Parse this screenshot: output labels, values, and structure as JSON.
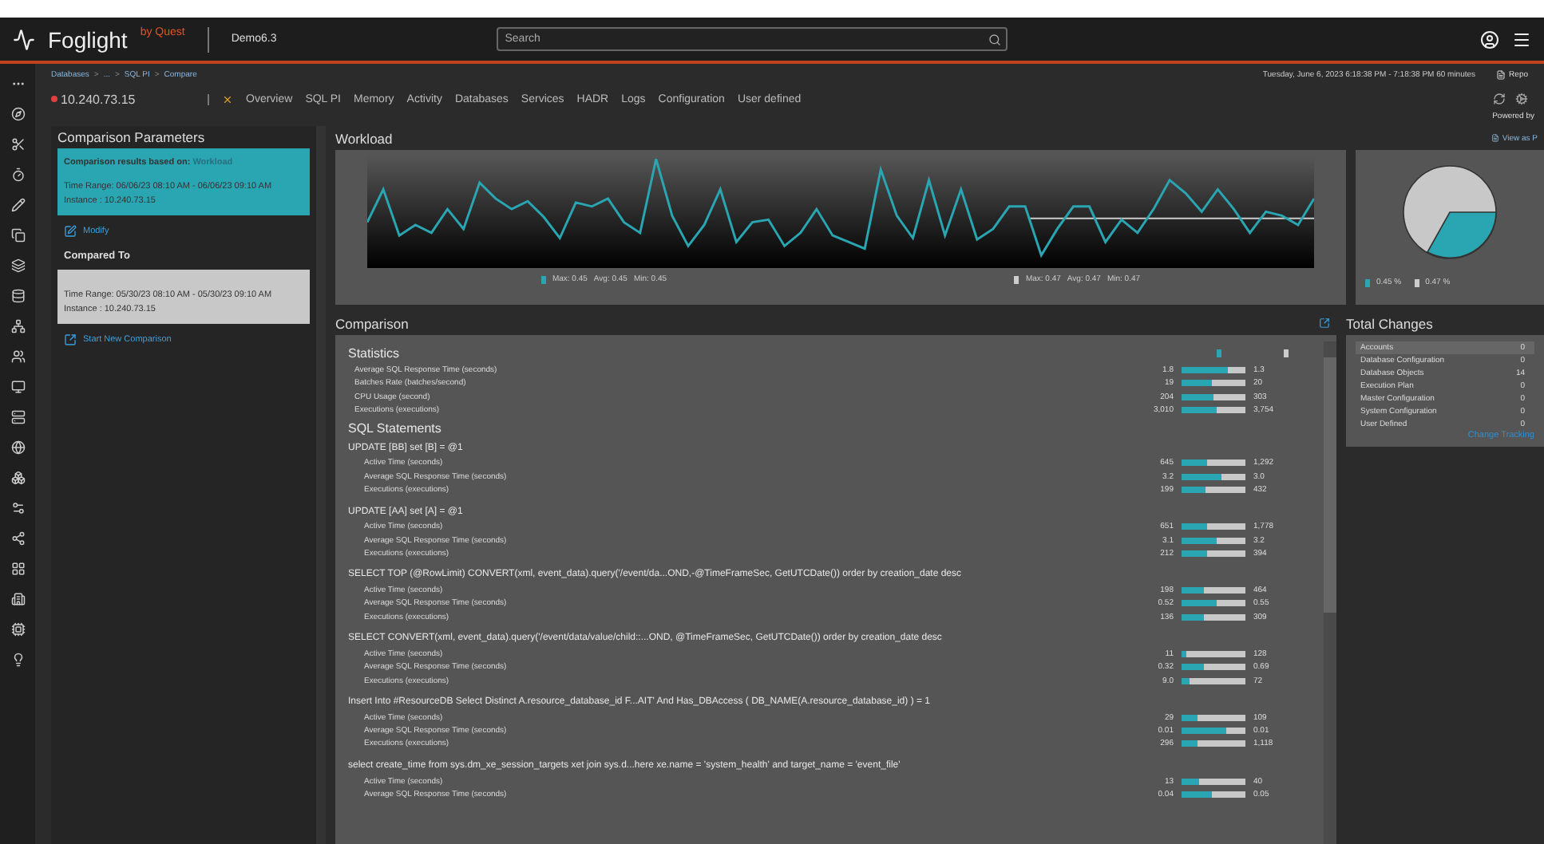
{
  "header": {
    "logo": "Foglight",
    "vendor": "by Quest",
    "instance": "Demo6.3",
    "search": {
      "placeholder": "Search"
    }
  },
  "breadcrumb": [
    {
      "label": "Databases"
    },
    {
      "separator": ">",
      "label": "..."
    },
    {
      "separator": ">",
      "label": "SQL PI"
    },
    {
      "separator": ">",
      "label": "Compare"
    }
  ],
  "time_range": "Tuesday, June 6, 2023 6:18:38 PM - 7:18:38 PM 60 minutes",
  "report": "Repo",
  "host": "10.240.73.15",
  "nav_tabs": [
    {
      "label": "Overview",
      "selected": false
    },
    {
      "label": "SQL PI",
      "selected": false
    },
    {
      "label": "Memory",
      "selected": false
    },
    {
      "label": "Activity",
      "selected": false
    },
    {
      "label": "Databases",
      "selected": false
    },
    {
      "label": "Services",
      "selected": false
    },
    {
      "label": "HADR",
      "selected": false
    },
    {
      "label": "Logs",
      "selected": false
    },
    {
      "label": "Configuration",
      "selected": false
    },
    {
      "label": "User defined",
      "selected": false
    }
  ],
  "powered_by": "Powered by",
  "comparison_parameters": {
    "title": "Comparison Parameters",
    "based_on_label": "Comparison results based on:",
    "based_on_value": "Workload",
    "baseline_time": "Time Range: 06/06/23 08:10 AM - 06/06/23 09:10 AM",
    "baseline_instance": "Instance : 10.240.73.15",
    "modify": "Modify",
    "compared_to": "Compared To",
    "compared_time": "Time Range: 05/30/23 08:10 AM - 05/30/23 09:10 AM",
    "compared_instance": "Instance : 10.240.73.15",
    "start_new": "Start New Comparison"
  },
  "workload": {
    "title": "Workload",
    "view_as": "View as P",
    "legend_a": [
      "Max: 0.45",
      "Avg: 0.45",
      "Min: 0.45"
    ],
    "legend_b": [
      "Max: 0.47",
      "Avg: 0.47",
      "Min: 0.47"
    ],
    "pie_legend": [
      "0.45 %",
      "0.47 %"
    ]
  },
  "comparison": {
    "title": "Comparison",
    "statistics_title": "Statistics",
    "statistics": [
      {
        "name": "Average SQL Response Time (seconds)",
        "a": "1.8",
        "b": "1.3",
        "level": 0.72
      },
      {
        "name": "Batches Rate (batches/second)",
        "a": "19",
        "b": "20",
        "level": 0.48
      },
      {
        "name": "CPU Usage (second)",
        "a": "204",
        "b": "303",
        "level": 0.5
      },
      {
        "name": "Executions (executions)",
        "a": "3,010",
        "b": "3,754",
        "level": 0.55
      }
    ],
    "sql_title": "SQL Statements",
    "statements": [
      {
        "text": "UPDATE [BB] set [B] = @1",
        "metrics": [
          {
            "name": "Active Time (seconds)",
            "a": "645",
            "b": "1,292",
            "level": 0.4
          },
          {
            "name": "Average SQL Response Time (seconds)",
            "a": "3.2",
            "b": "3.0",
            "level": 0.62
          },
          {
            "name": "Executions (executions)",
            "a": "199",
            "b": "432",
            "level": 0.37
          }
        ]
      },
      {
        "text": "UPDATE [AA] set [A] = @1",
        "metrics": [
          {
            "name": "Active Time (seconds)",
            "a": "651",
            "b": "1,778",
            "level": 0.4
          },
          {
            "name": "Average SQL Response Time (seconds)",
            "a": "3.1",
            "b": "3.2",
            "level": 0.56
          },
          {
            "name": "Executions (executions)",
            "a": "212",
            "b": "394",
            "level": 0.4
          }
        ]
      },
      {
        "text": "SELECT TOP (@RowLimit) CONVERT(xml, event_data).query('/event/da...OND,-@TimeFrameSec, GetUTCDate()) order by creation_date desc",
        "metrics": [
          {
            "name": "Active Time (seconds)",
            "a": "198",
            "b": "464",
            "level": 0.35
          },
          {
            "name": "Average SQL Response Time (seconds)",
            "a": "0.52",
            "b": "0.55",
            "level": 0.56
          },
          {
            "name": "Executions (executions)",
            "a": "136",
            "b": "309",
            "level": 0.36
          }
        ]
      },
      {
        "text": "SELECT CONVERT(xml, event_data).query('/event/data/value/child::...OND, @TimeFrameSec, GetUTCDate()) order by creation_date desc",
        "metrics": [
          {
            "name": "Active Time (seconds)",
            "a": "11",
            "b": "128",
            "level": 0.08
          },
          {
            "name": "Average SQL Response Time (seconds)",
            "a": "0.32",
            "b": "0.69",
            "level": 0.36
          },
          {
            "name": "Executions (executions)",
            "a": "9.0",
            "b": "72",
            "level": 0.12
          }
        ]
      },
      {
        "text": "Insert Into #ResourceDB Select Distinct A.resource_database_id F...AIT' And Has_DBAccess ( DB_NAME(A.resource_database_id) ) = 1",
        "metrics": [
          {
            "name": "Active Time (seconds)",
            "a": "29",
            "b": "109",
            "level": 0.25
          },
          {
            "name": "Average SQL Response Time (seconds)",
            "a": "0.01",
            "b": "0.01",
            "level": 0.7
          },
          {
            "name": "Executions (executions)",
            "a": "296",
            "b": "1,118",
            "level": 0.24
          }
        ]
      },
      {
        "text": "select create_time from sys.dm_xe_session_targets xet join sys.d...here xe.name = 'system_health' and target_name = 'event_file'",
        "metrics": [
          {
            "name": "Active Time (seconds)",
            "a": "13",
            "b": "40",
            "level": 0.28
          },
          {
            "name": "Average SQL Response Time (seconds)",
            "a": "0.04",
            "b": "0.05",
            "level": 0.48
          }
        ]
      }
    ]
  },
  "total_changes": {
    "title": "Total Changes",
    "items": [
      {
        "label": "Accounts",
        "count": "0",
        "selected": true
      },
      {
        "label": "Database Configuration",
        "count": "0",
        "selected": false
      },
      {
        "label": "Database Objects",
        "count": "14",
        "selected": false
      },
      {
        "label": "Execution Plan",
        "count": "0",
        "selected": false
      },
      {
        "label": "Master Configuration",
        "count": "0",
        "selected": false
      },
      {
        "label": "System Configuration",
        "count": "0",
        "selected": false
      },
      {
        "label": "User Defined",
        "count": "0",
        "selected": false
      }
    ],
    "link": "Change Tracking"
  }
}
